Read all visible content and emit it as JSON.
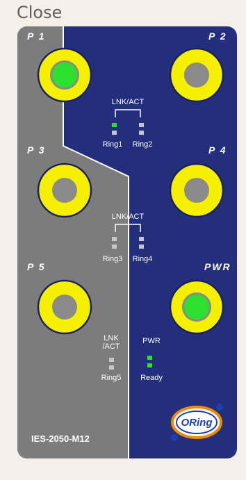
{
  "header": {
    "close_label": "Close"
  },
  "device": {
    "model": "IES-2050-M12",
    "brand": "ORing",
    "colors": {
      "panel_blue": "#232f7c",
      "panel_gray": "#7c7c7c",
      "port_yellow": "#f4f000",
      "port_gray": "#8a8a8a",
      "led_green": "#2ee02e",
      "led_off": "#c6c6c6"
    },
    "ports": [
      {
        "label": "P 1",
        "state": "active"
      },
      {
        "label": "P 2",
        "state": "inactive"
      },
      {
        "label": "P 3",
        "state": "inactive"
      },
      {
        "label": "P 4",
        "state": "inactive"
      },
      {
        "label": "P 5",
        "state": "inactive"
      },
      {
        "label": "PWR",
        "state": "active"
      }
    ],
    "lnk_act_label": "LNK/ACT",
    "lnk_act_label_wrapped": [
      "LNK",
      "/ACT"
    ],
    "ring_labels": [
      "Ring1",
      "Ring2",
      "Ring3",
      "Ring4",
      "Ring5"
    ],
    "pwr_label": "PWR",
    "ready_label": "Ready",
    "leds": {
      "ring1": [
        "on",
        "off"
      ],
      "ring2": [
        "off",
        "off"
      ],
      "ring3": [
        "off",
        "off"
      ],
      "ring4": [
        "off",
        "off"
      ],
      "ring5": [
        "off",
        "off"
      ],
      "pwr_ready": [
        "on",
        "on"
      ]
    }
  }
}
